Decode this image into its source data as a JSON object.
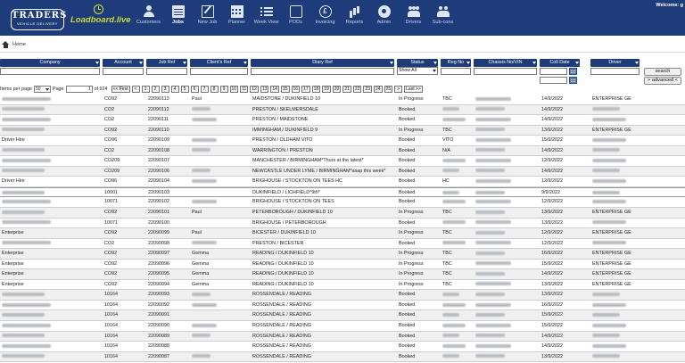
{
  "header": {
    "logo_main": "TRADERS",
    "logo_sub": "VEHICLE DELIVERY",
    "logo_loadboard": "Loadboard.live",
    "welcome": "Welcome: g",
    "nav": [
      {
        "label": "Customers",
        "icon": "customers-icon",
        "active": false
      },
      {
        "label": "Jobs",
        "icon": "jobs-icon",
        "active": true
      },
      {
        "label": "New Job",
        "icon": "new-job-icon",
        "active": false
      },
      {
        "label": "Planner",
        "icon": "planner-icon",
        "active": false
      },
      {
        "label": "Week View",
        "icon": "week-view-icon",
        "active": false
      },
      {
        "label": "PODs",
        "icon": "pods-icon",
        "active": false
      },
      {
        "label": "Invoicing",
        "icon": "invoicing-icon",
        "active": false
      },
      {
        "label": "Reports",
        "icon": "reports-icon",
        "active": false
      },
      {
        "label": "Admin",
        "icon": "admin-icon",
        "active": false
      },
      {
        "label": "Drivers",
        "icon": "drivers-icon",
        "active": false
      },
      {
        "label": "Sub-cons",
        "icon": "subcons-icon",
        "active": false
      }
    ]
  },
  "breadcrumb": {
    "home": "Home"
  },
  "filters": {
    "columns": {
      "company": "Company",
      "account": "Account",
      "job_ref": "Job Ref",
      "clients_ref": "Client's Ref",
      "diary_ref": "Diary Ref",
      "status": "Status",
      "reg_no": "Reg No",
      "chassis": "Chassis No/VIN",
      "coll_date": "Coll Date",
      "driver": "Driver"
    },
    "status_value": "Show All",
    "search_label": "search",
    "advanced_label": "> advanced <"
  },
  "paging": {
    "items_per_page_label": "Items per page",
    "items_per_page": "50",
    "page_label": "Page",
    "page_value": "1",
    "of_label": "of 924",
    "first_label": "<< First",
    "prev_label": "<",
    "pages": [
      "1",
      "2",
      "3",
      "4",
      "5",
      "6",
      "7",
      "8",
      "9",
      "10",
      "11",
      "12",
      "13",
      "14",
      "15",
      "16",
      "17",
      "18",
      "19",
      "20",
      "21",
      "22",
      "23",
      "24",
      "25"
    ],
    "next_label": ">",
    "last_label": "Last >>"
  },
  "rows": [
    {
      "company": "",
      "account": "CO92",
      "job": "22090113",
      "client": "Paul",
      "diary": "MAIDSTONE / DUKINFIELD 10",
      "status": "In Progress",
      "reg": "TBC",
      "coll": "14/9/2022",
      "driver": "ENTERPRISE GE"
    },
    {
      "company": "",
      "account": "CO2",
      "job": "22090112",
      "client": "",
      "diary": "PRESTON / SKELMERSDALE",
      "status": "Booked",
      "reg": "",
      "coll": "14/9/2022",
      "driver": ""
    },
    {
      "company": "",
      "account": "CO2",
      "job": "22090111",
      "client": "",
      "diary": "PRESTON / MAIDSTONE",
      "status": "Booked",
      "reg": "",
      "coll": "14/9/2022",
      "driver": ""
    },
    {
      "company": "",
      "account": "CO92",
      "job": "22090110",
      "client": "",
      "diary": "IMMINGHAM / DUKINFIELD 9",
      "status": "In Progress",
      "reg": "TBC",
      "coll": "13/9/2022",
      "driver": "ENTERPRISE GE"
    },
    {
      "company": "Driver Hire",
      "account": "CO96",
      "job": "22090109",
      "client": "",
      "diary": "PRESTON / OLDHAM VITO",
      "status": "Booked",
      "reg": "VITO",
      "coll": "15/9/2022",
      "driver": ""
    },
    {
      "company": "",
      "account": "CO2",
      "job": "22090108",
      "client": "",
      "diary": "WARRINGTON / PRESTON",
      "status": "Booked",
      "reg": "N/A",
      "coll": "14/9/2022",
      "driver": ""
    },
    {
      "company": "",
      "account": "CO209",
      "job": "22090107",
      "client": "",
      "diary": "MANCHESTER / BIRMINGHAM*Thurs at the latest*",
      "status": "Booked",
      "reg": "",
      "coll": "12/9/2022",
      "driver": ""
    },
    {
      "company": "",
      "account": "CO209",
      "job": "22090106",
      "client": "",
      "diary": "NEWCASTLE UNDER LYME / BIRMINGHAM*asap this week*",
      "status": "Booked",
      "reg": "",
      "coll": "14/9/2022",
      "driver": ""
    },
    {
      "company": "Driver Hire",
      "account": "CO96",
      "job": "22090104",
      "client": "",
      "diary": "BRIGHOUSE / STOCKTON ON TEES HC",
      "status": "Booked",
      "reg": "HC",
      "coll": "12/9/2022",
      "driver": ""
    },
    {
      "company": "",
      "account": "10001",
      "job": "22090103",
      "client": "",
      "diary": "DUKINFIELD / LICHFIELD*9th*",
      "status": "Booked",
      "reg": "",
      "coll": "9/9/2022",
      "driver": ""
    },
    {
      "company": "",
      "account": "10071",
      "job": "22090102",
      "client": "",
      "diary": "BRIGHOUSE / STOCKTON ON TEES",
      "status": "Booked",
      "reg": "",
      "coll": "12/9/2022",
      "driver": ""
    },
    {
      "company": "",
      "account": "CO92",
      "job": "22090101",
      "client": "Paul",
      "diary": "PETERBOROUGH / DUKINFIELD 10",
      "status": "In Progress",
      "reg": "TBC",
      "coll": "13/9/2022",
      "driver": "ENTERPRISE GE"
    },
    {
      "company": "",
      "account": "10071",
      "job": "22090100",
      "client": "",
      "diary": "BRIGHOUSE / PETERBOROUGH",
      "status": "Booked",
      "reg": "",
      "coll": "13/9/2022",
      "driver": ""
    },
    {
      "company": "Enterprise",
      "account": "CO92",
      "job": "22090099",
      "client": "Paul",
      "diary": "BICESTER / DUKINFIELD 10",
      "status": "In Progress",
      "reg": "TBC",
      "coll": "12/9/2022",
      "driver": "ENTERPRISE GE"
    },
    {
      "company": "",
      "account": "CO2",
      "job": "22090098",
      "client": "",
      "diary": "PRESTON / BICESTER",
      "status": "Booked",
      "reg": "",
      "coll": "12/9/2022",
      "driver": ""
    },
    {
      "company": "Enterprise",
      "account": "CO92",
      "job": "22090097",
      "client": "Gemma",
      "diary": "READING / DUKINFIELD 10",
      "status": "In Progress",
      "reg": "TBC",
      "coll": "16/9/2022",
      "driver": "ENTERPRISE GE"
    },
    {
      "company": "Enterprise",
      "account": "CO92",
      "job": "22090096",
      "client": "Gemma",
      "diary": "READING / DUKINFIELD 10",
      "status": "In Progress",
      "reg": "TBC",
      "coll": "15/9/2022",
      "driver": "ENTERPRISE GE"
    },
    {
      "company": "Enterprise",
      "account": "CO92",
      "job": "22090095",
      "client": "Gemma",
      "diary": "READING / DUKINFIELD 10",
      "status": "In Progress",
      "reg": "TBC",
      "coll": "14/9/2022",
      "driver": "ENTERPRISE GE"
    },
    {
      "company": "Enterprise",
      "account": "CO92",
      "job": "22090094",
      "client": "Gemma",
      "diary": "READING / DUKINFIELD 10",
      "status": "In Progress",
      "reg": "TBC",
      "coll": "13/9/2022",
      "driver": "ENTERPRISE GE"
    },
    {
      "company": "",
      "account": "10164",
      "job": "22090093",
      "client": "",
      "diary": "ROSSENDALE / READING",
      "status": "Booked",
      "reg": "",
      "coll": "13/9/2022",
      "driver": ""
    },
    {
      "company": "",
      "account": "10164",
      "job": "22090092",
      "client": "",
      "diary": "ROSSENDALE / READING",
      "status": "Booked",
      "reg": "",
      "coll": "16/9/2022",
      "driver": ""
    },
    {
      "company": "",
      "account": "10164",
      "job": "22090091",
      "client": "",
      "diary": "ROSSENDALE / READING",
      "status": "Booked",
      "reg": "",
      "coll": "15/9/2022",
      "driver": ""
    },
    {
      "company": "",
      "account": "10164",
      "job": "22090090",
      "client": "",
      "diary": "ROSSENDALE / READING",
      "status": "Booked",
      "reg": "",
      "coll": "15/9/2022",
      "driver": ""
    },
    {
      "company": "",
      "account": "10164",
      "job": "22090089",
      "client": "",
      "diary": "ROSSENDALE / READING",
      "status": "Booked",
      "reg": "",
      "coll": "14/9/2022",
      "driver": ""
    },
    {
      "company": "",
      "account": "10164",
      "job": "22090088",
      "client": "",
      "diary": "ROSSENDALE / READING",
      "status": "Booked",
      "reg": "",
      "coll": "14/9/2022",
      "driver": ""
    },
    {
      "company": "",
      "account": "10164",
      "job": "22090087",
      "client": "",
      "diary": "ROSSENDALE / READING",
      "status": "Booked",
      "reg": "",
      "coll": "13/9/2022",
      "driver": ""
    }
  ]
}
